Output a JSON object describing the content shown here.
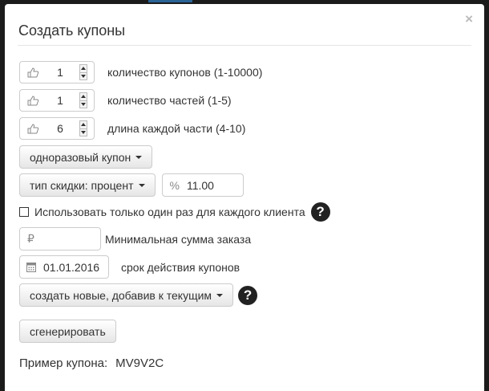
{
  "dialog": {
    "title": "Создать купоны",
    "close_glyph": "×"
  },
  "spinners": [
    {
      "value": "1",
      "label": "количество купонов (1-10000)",
      "icon": "thumbs-up-icon"
    },
    {
      "value": "1",
      "label": "количество частей (1-5)",
      "icon": "thumbs-up-icon"
    },
    {
      "value": "6",
      "label": "длина каждой части (4-10)",
      "icon": "thumbs-up-icon"
    }
  ],
  "coupon_type": {
    "label": "одноразовый купон"
  },
  "discount": {
    "type_label": "тип скидки: процент",
    "symbol": "%",
    "value": "11.00"
  },
  "once_per_client": {
    "label": "Использовать только один раз для каждого клиента",
    "checked": false,
    "help": "?"
  },
  "min_order": {
    "symbol": "₽",
    "value": "",
    "label": "Минимальная сумма заказа"
  },
  "expiry": {
    "value": "01.01.2016",
    "label": "срок действия купонов",
    "icon": "calendar-icon"
  },
  "mode": {
    "label": "создать новые, добавив к текущим",
    "help": "?"
  },
  "generate": {
    "label": "сгенерировать"
  },
  "example": {
    "label": "Пример купона:",
    "code": "MV9V2C"
  },
  "colors": {
    "accent": "#2a6496",
    "backdrop": "#1b1b1b",
    "help_bg": "#222222"
  }
}
